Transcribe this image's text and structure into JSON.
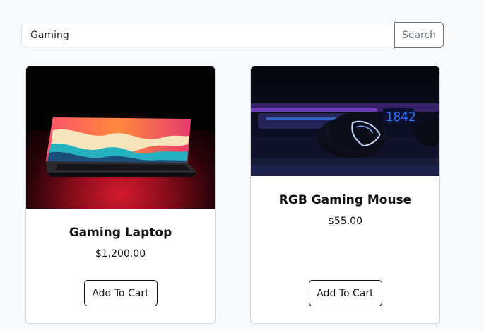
{
  "search": {
    "value": "Gaming",
    "button_label": "Search"
  },
  "products": [
    {
      "title": "Gaming Laptop",
      "price": "$1,200.00",
      "button_label": "Add To Cart",
      "image": "laptop-photo"
    },
    {
      "title": "RGB Gaming Mouse",
      "price": "$55.00",
      "button_label": "Add To Cart",
      "image": "mouse-photo"
    }
  ],
  "colors": {
    "background": "#f8f9fb",
    "card_border": "#d3d6da",
    "search_button_border": "#6c757d",
    "text": "#111111"
  }
}
